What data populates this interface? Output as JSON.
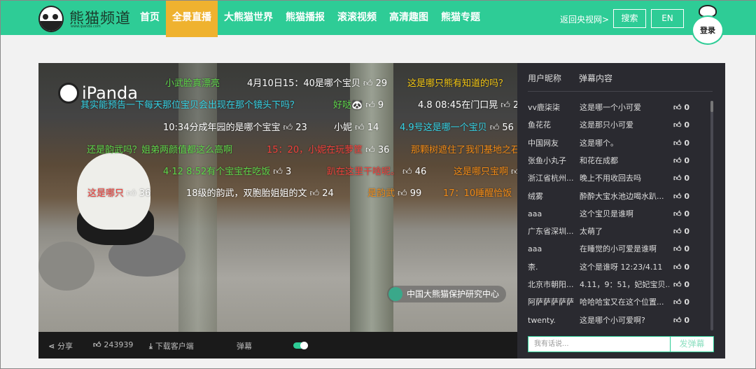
{
  "header": {
    "brand": "熊猫频道",
    "brand_url": "www.ipanda.com",
    "nav": [
      "首页",
      "全景直播",
      "大熊猫世界",
      "熊猫播报",
      "滚滚视频",
      "高清趣图",
      "熊猫专题"
    ],
    "active_nav": 1,
    "back_link": "返回央视网>",
    "search": "搜索",
    "lang": "EN",
    "login": "登录"
  },
  "video": {
    "logo_text": "iPanda",
    "watermark": "中国大熊猫保护研究中心",
    "next_icon": "chevron-right-icon",
    "danmaku": [
      {
        "text": "小武脸真漂亮",
        "color": "#5ed64a"
      },
      {
        "text": "4月10日15：40是哪个宝贝",
        "likes": "29",
        "color": "#ffffff"
      },
      {
        "text": "这是哪只熊有知道的吗？",
        "color": "#f3c613"
      },
      {
        "text": "其实能预告一下每天那位宝贝会出现在那个镜头下吗？",
        "color": "#35d3e6"
      },
      {
        "text": "好哒🐼",
        "likes": "9",
        "color": "#5ed64a"
      },
      {
        "text": "4.8 08:45在门口晃",
        "likes": "2",
        "color": "#ffffff"
      },
      {
        "text": "10:34分成年园的是哪个宝宝",
        "likes": "23",
        "color": "#ffffff"
      },
      {
        "text": "小妮",
        "likes": "14",
        "color": "#ffffff"
      },
      {
        "text": "4.9号这是哪一个宝贝",
        "likes": "56",
        "color": "#35d3e6"
      },
      {
        "text": "还是韵武吗？姐弟两颜值都这么高啊",
        "color": "#5ed64a"
      },
      {
        "text": "15：20，小妮在玩萝筐",
        "likes": "36",
        "color": "#f0413c"
      },
      {
        "text": "那颗树遮住了我们基地之石",
        "color": "#f08a16"
      },
      {
        "text": "4·12 8:52有个宝宝在吃饭",
        "likes": "3",
        "color": "#5ed64a"
      },
      {
        "text": "趴在这里干啥呢。",
        "likes": "46",
        "color": "#f0413c"
      },
      {
        "text": "这是哪只宝啊",
        "likes": "",
        "color": "#f08a16"
      },
      {
        "text": "这是哪只",
        "likes": "36",
        "color": "#f0413c"
      },
      {
        "text": "18级的韵武，双胞胎姐姐的文",
        "likes": "24",
        "color": "#ffffff"
      },
      {
        "text": "是韵武",
        "likes": "99",
        "color": "#f08a16"
      },
      {
        "text": "17：10睡醒恰饭",
        "color": "#f08a16"
      }
    ]
  },
  "controls": {
    "share": "分享",
    "likes": "243939",
    "download": "下载客户端",
    "danmaku_toggle": "弹幕",
    "danmaku_on": true
  },
  "panel": {
    "col_user": "用户昵称",
    "col_content": "弹幕内容",
    "rows": [
      {
        "user": "vv鹿柒柒",
        "content": "这是哪一个小可爱",
        "likes": "0"
      },
      {
        "user": "鱼花花",
        "content": "这是那只小可爱",
        "likes": "0"
      },
      {
        "user": "中国网友",
        "content": "这是哪个。",
        "likes": "0"
      },
      {
        "user": "张鱼小丸子",
        "content": "和花在成都",
        "likes": "0"
      },
      {
        "user": "浙江省杭州...",
        "content": "晚上不用收回去吗",
        "likes": "0"
      },
      {
        "user": "绒雾",
        "content": "酔酔大宝水池边喝水趴...",
        "likes": "0"
      },
      {
        "user": "aaa",
        "content": "这个宝贝是谁啊",
        "likes": "0"
      },
      {
        "user": "广东省深圳...",
        "content": "太萌了",
        "likes": "0"
      },
      {
        "user": "aaa",
        "content": "在睡觉的小可爱是谁啊",
        "likes": "0"
      },
      {
        "user": "柰.",
        "content": "这个是谁呀 12:23/4.11",
        "likes": "0"
      },
      {
        "user": "北京市朝阳...",
        "content": "4.11，9：51，妃妃宝贝...",
        "likes": "0"
      },
      {
        "user": "阿萨萨萨萨萨",
        "content": "哈哈哈宝又在这个位置...",
        "likes": "0"
      },
      {
        "user": "twenty.",
        "content": "这是哪个小可爱啊?",
        "likes": "0"
      }
    ],
    "input_placeholder": "我有话说...",
    "send": "发弹幕"
  },
  "colors": {
    "brand": "#2ecc96",
    "active_nav": "#efb22f",
    "panel_bg": "#2a2a30"
  }
}
